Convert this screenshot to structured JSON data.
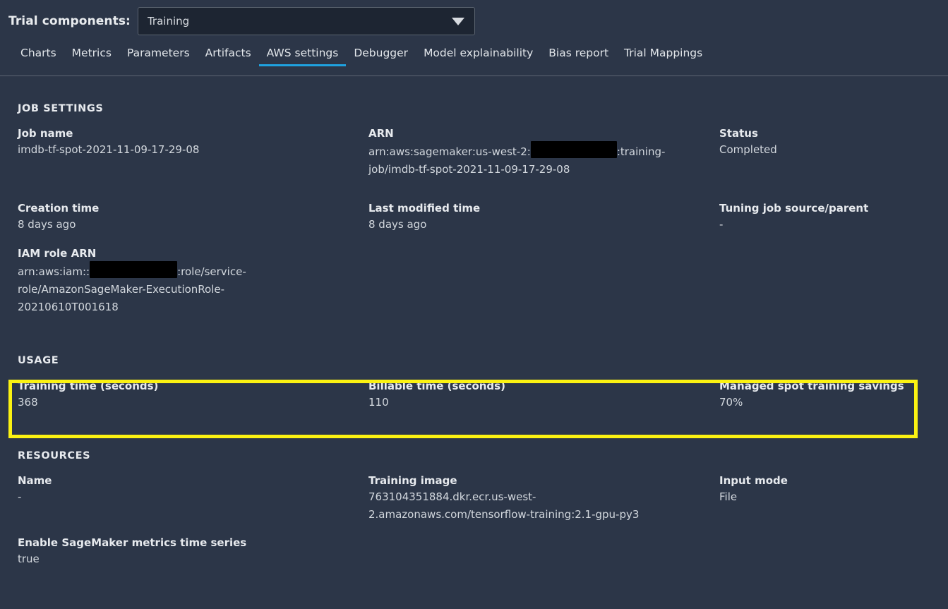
{
  "header": {
    "label": "Trial components:",
    "select": {
      "value": "Training",
      "icon": "chevron-down-icon"
    }
  },
  "tabs": [
    {
      "label": "Charts",
      "active": false
    },
    {
      "label": "Metrics",
      "active": false
    },
    {
      "label": "Parameters",
      "active": false
    },
    {
      "label": "Artifacts",
      "active": false
    },
    {
      "label": "AWS settings",
      "active": true
    },
    {
      "label": "Debugger",
      "active": false
    },
    {
      "label": "Model explainability",
      "active": false
    },
    {
      "label": "Bias report",
      "active": false
    },
    {
      "label": "Trial Mappings",
      "active": false
    }
  ],
  "sections": {
    "job_settings": {
      "title": "JOB SETTINGS",
      "job_name": {
        "label": "Job name",
        "value": "imdb-tf-spot-2021-11-09-17-29-08"
      },
      "arn": {
        "label": "ARN",
        "value_prefix": "arn:aws:sagemaker:us-west-2:",
        "value_suffix": ":training-job/imdb-tf-spot-2021-11-09-17-29-08",
        "redacted": true
      },
      "status": {
        "label": "Status",
        "value": "Completed"
      },
      "creation_time": {
        "label": "Creation time",
        "value": "8 days ago"
      },
      "last_modified_time": {
        "label": "Last modified time",
        "value": "8 days ago"
      },
      "tuning_job_source": {
        "label": "Tuning job source/parent",
        "value": "-"
      },
      "iam_role_arn": {
        "label": "IAM role ARN",
        "value_prefix": "arn:aws:iam::",
        "value_suffix": ":role/service-role/AmazonSageMaker-ExecutionRole-20210610T001618",
        "redacted": true
      }
    },
    "usage": {
      "title": "USAGE",
      "highlight_color": "#fbf212",
      "training_time": {
        "label": "Training time (seconds)",
        "value": "368"
      },
      "billable_time": {
        "label": "Billable time (seconds)",
        "value": "110"
      },
      "spot_savings": {
        "label": "Managed spot training savings",
        "value": "70%"
      }
    },
    "resources": {
      "title": "RESOURCES",
      "name": {
        "label": "Name",
        "value": "-"
      },
      "training_image": {
        "label": "Training image",
        "value": "763104351884.dkr.ecr.us-west-2.amazonaws.com/tensorflow-training:2.1-gpu-py3"
      },
      "input_mode": {
        "label": "Input mode",
        "value": "File"
      },
      "metrics_time_series": {
        "label": "Enable SageMaker metrics time series",
        "value": "true"
      }
    }
  },
  "colors": {
    "background": "#2c3648",
    "accent_tab": "#1fa2e0",
    "highlight": "#fbf212",
    "select_background": "#1d2532"
  }
}
